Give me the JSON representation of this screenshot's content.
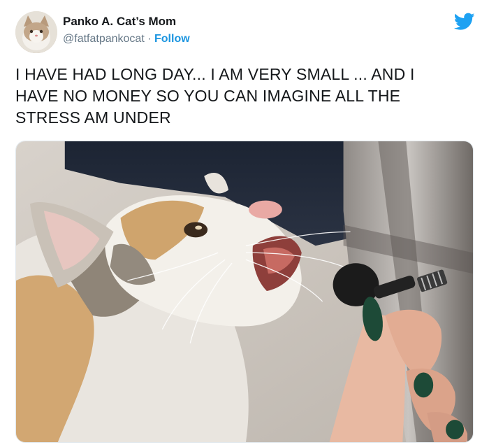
{
  "author": {
    "display_name": "Panko A. Cat’s Mom",
    "handle": "@fatfatpankocat",
    "separator": "·",
    "follow_label": "Follow"
  },
  "tweet": {
    "text": "I HAVE HAD LONG DAY... I AM VERY SMALL ... AND I\nHAVE NO MONEY SO YOU CAN IMAGINE ALL THE\nSTRESS AM UNDER"
  },
  "icons": {
    "brand": "twitter-bird-icon"
  },
  "colors": {
    "twitter_blue": "#1da1f2",
    "follow_blue": "#1b95e0",
    "text_primary": "#14171a",
    "text_secondary": "#657786"
  }
}
